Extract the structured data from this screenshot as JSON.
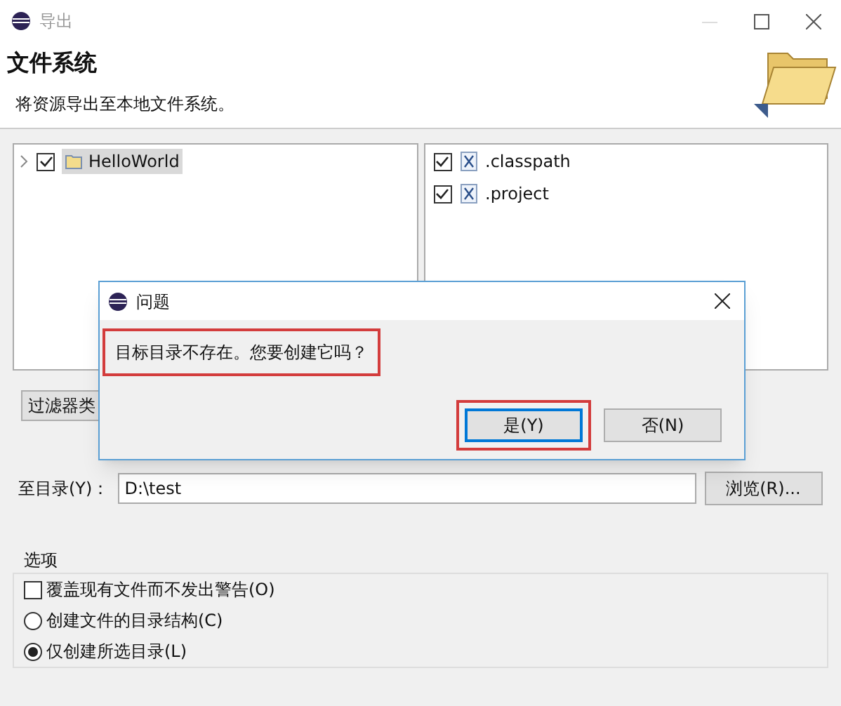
{
  "window": {
    "title": "导出"
  },
  "header": {
    "title": "文件系统",
    "description": "将资源导出至本地文件系统。"
  },
  "left_tree": [
    {
      "label": "HelloWorld",
      "checked": true,
      "expanded": false,
      "selected": true
    }
  ],
  "right_list": [
    {
      "label": ".classpath",
      "checked": true
    },
    {
      "label": ".project",
      "checked": true
    }
  ],
  "filter_button": "过滤器类",
  "destination": {
    "label": "至目录(Y)：",
    "value": "D:\\test",
    "browse_button": "浏览(R)..."
  },
  "options": {
    "title": "选项",
    "items": [
      {
        "kind": "checkbox",
        "label": "覆盖现有文件而不发出警告(O)",
        "checked": false
      },
      {
        "kind": "radio",
        "label": "创建文件的目录结构(C)",
        "selected": false
      },
      {
        "kind": "radio",
        "label": "仅创建所选目录(L)",
        "selected": true
      }
    ]
  },
  "dialog": {
    "title": "问题",
    "message": "目标目录不存在。您要创建它吗？",
    "buttons": [
      {
        "label": "是(Y)",
        "selected": true
      },
      {
        "label": "否(N)",
        "selected": false
      }
    ]
  }
}
